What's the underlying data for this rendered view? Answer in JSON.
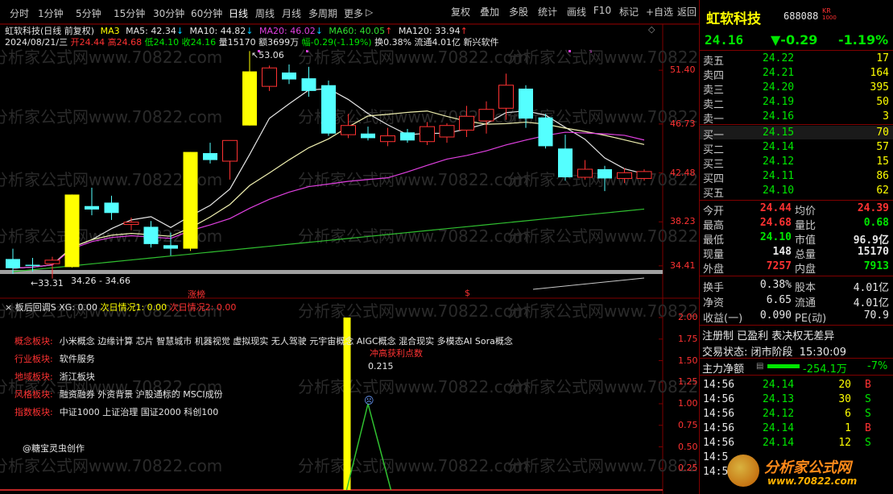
{
  "toolbar": {
    "periods": [
      "分时",
      "1分钟",
      "5分钟",
      "15分钟",
      "30分钟",
      "60分钟",
      "日线",
      "周线",
      "月线",
      "多周期",
      "更多"
    ],
    "active_period": "日线",
    "more_arrow": "▷",
    "buttons": [
      "复权",
      "叠加",
      "多股",
      "统计",
      "画线",
      "F10",
      "标记",
      "+自选",
      "返回"
    ]
  },
  "chart": {
    "stock_label": "虹软科技(日线 前复权)",
    "ma3": "MA3",
    "ma5": "MA5: 42.34",
    "ma5_arrow": "↓",
    "ma10": "MA10: 44.82",
    "ma10_arrow": "↓",
    "ma20": "MA20: 46.02",
    "ma20_arrow": "↓",
    "ma60": "MA60: 40.05",
    "ma60_arrow": "↑",
    "ma120": "MA120: 33.94",
    "ma120_arrow": "↑",
    "date": "2024/08/21/三",
    "open": "开24.44",
    "high": "高24.68",
    "low": "低24.10",
    "close": "收24.16",
    "volume": "量15170",
    "amount": "额3699万",
    "change": "幅-0.29(-1.19%)",
    "turnover": "换0.38%",
    "float": "流通4.01亿",
    "sector": "新兴软件",
    "y_ticks": [
      "51.40",
      "46.73",
      "42.48",
      "38.23",
      "34.41"
    ],
    "y_values": [
      51.4,
      46.73,
      42.48,
      38.23,
      34.41
    ],
    "high_mark": "53.06",
    "low_mark": "33.31",
    "range_text": "34.26 - 34.66",
    "tag_zt": "涨榜",
    "tag_s": "$",
    "candles": [
      {
        "o": 35.0,
        "h": 35.9,
        "l": 33.7,
        "c": 34.2
      },
      {
        "o": 34.5,
        "h": 35.1,
        "l": 33.9,
        "c": 34.4
      },
      {
        "o": 34.6,
        "h": 35.2,
        "l": 33.31,
        "c": 34.9
      },
      {
        "o": 34.3,
        "h": 40.6,
        "l": 34.26,
        "c": 40.6
      },
      {
        "o": 39.6,
        "h": 41.2,
        "l": 38.8,
        "c": 39.3
      },
      {
        "o": 39.9,
        "h": 40.5,
        "l": 38.4,
        "c": 39.0
      },
      {
        "o": 38.0,
        "h": 38.6,
        "l": 37.5,
        "c": 38.2
      },
      {
        "o": 37.8,
        "h": 38.3,
        "l": 36.0,
        "c": 36.3
      },
      {
        "o": 36.2,
        "h": 37.3,
        "l": 35.3,
        "c": 35.9
      },
      {
        "o": 35.9,
        "h": 44.3,
        "l": 35.7,
        "c": 44.3
      },
      {
        "o": 44.2,
        "h": 45.1,
        "l": 43.3,
        "c": 43.6
      },
      {
        "o": 43.5,
        "h": 45.3,
        "l": 41.9,
        "c": 45.3
      },
      {
        "o": 46.6,
        "h": 53.06,
        "l": 46.6,
        "c": 51.3
      },
      {
        "o": 50.0,
        "h": 51.8,
        "l": 49.6,
        "c": 51.6
      },
      {
        "o": 51.2,
        "h": 51.9,
        "l": 50.2,
        "c": 50.6
      },
      {
        "o": 50.7,
        "h": 51.7,
        "l": 49.1,
        "c": 49.6
      },
      {
        "o": 50.1,
        "h": 50.5,
        "l": 45.7,
        "c": 45.9
      },
      {
        "o": 45.8,
        "h": 47.6,
        "l": 45.5,
        "c": 46.6
      },
      {
        "o": 45.9,
        "h": 46.5,
        "l": 45.3,
        "c": 45.5
      },
      {
        "o": 45.2,
        "h": 46.4,
        "l": 44.8,
        "c": 45.7
      },
      {
        "o": 46.0,
        "h": 46.3,
        "l": 45.1,
        "c": 45.3
      },
      {
        "o": 45.2,
        "h": 46.9,
        "l": 44.9,
        "c": 46.5
      },
      {
        "o": 45.6,
        "h": 46.8,
        "l": 45.1,
        "c": 46.6
      },
      {
        "o": 46.2,
        "h": 48.3,
        "l": 45.6,
        "c": 47.4
      },
      {
        "o": 47.0,
        "h": 48.7,
        "l": 45.9,
        "c": 48.0
      },
      {
        "o": 48.1,
        "h": 51.1,
        "l": 47.1,
        "c": 50.1
      },
      {
        "o": 49.8,
        "h": 50.1,
        "l": 46.4,
        "c": 47.2
      },
      {
        "o": 47.3,
        "h": 47.6,
        "l": 44.6,
        "c": 44.8
      },
      {
        "o": 44.6,
        "h": 45.8,
        "l": 41.8,
        "c": 42.1
      },
      {
        "o": 42.1,
        "h": 43.6,
        "l": 41.9,
        "c": 42.8
      },
      {
        "o": 42.8,
        "h": 43.1,
        "l": 40.9,
        "c": 42.0
      },
      {
        "o": 42.0,
        "h": 42.9,
        "l": 41.6,
        "c": 42.5
      },
      {
        "o": 42.0,
        "h": 42.8,
        "l": 41.8,
        "c": 42.6
      }
    ]
  },
  "indicator": {
    "title": "板后回调S",
    "xg": "XG: 0.00",
    "cond1": "次日情况1: 0.00",
    "cond2": "次日情况2: 0.00",
    "y_ticks": [
      "2.00",
      "1.75",
      "1.50",
      "1.25",
      "1.00",
      "0.75",
      "0.50",
      "0.25"
    ],
    "y_values": [
      2.0,
      1.75,
      1.5,
      1.25,
      1.0,
      0.75,
      0.5,
      0.25
    ],
    "annotation": "冲高获利点数",
    "annotation_value": "0.215",
    "tags": [
      {
        "label": "概念板块:",
        "value": "小米概念 边缘计算 芯片 智慧城市 机器视觉 虚拟现实 无人驾驶 元宇宙概念 AIGC概念 混合现实 多模态AI Sora概念"
      },
      {
        "label": "行业板块:",
        "value": "软件服务"
      },
      {
        "label": "地域板块:",
        "value": "浙江板块"
      },
      {
        "label": "风格板块:",
        "value": "融资融券 外资背景 沪股通标的 MSCI成份"
      },
      {
        "label": "指数板块:",
        "value": "中证1000 上证治理 国证2000 科创100"
      }
    ],
    "credit": "@糖宝灵虫创作"
  },
  "watermark": "分析家公式网www.70822.com",
  "quote": {
    "name": "虹软科技",
    "code": "688088",
    "badge_top": "KR",
    "badge_bottom": "1000",
    "price": "24.16",
    "change": "▼-0.29",
    "change_pct": "-1.19%",
    "asks": [
      {
        "label": "卖五",
        "price": "24.22",
        "vol": "17"
      },
      {
        "label": "卖四",
        "price": "24.21",
        "vol": "164"
      },
      {
        "label": "卖三",
        "price": "24.20",
        "vol": "395"
      },
      {
        "label": "卖二",
        "price": "24.19",
        "vol": "50"
      },
      {
        "label": "卖一",
        "price": "24.16",
        "vol": "3"
      }
    ],
    "bids": [
      {
        "label": "买一",
        "price": "24.15",
        "vol": "70"
      },
      {
        "label": "买二",
        "price": "24.14",
        "vol": "57"
      },
      {
        "label": "买三",
        "price": "24.12",
        "vol": "15"
      },
      {
        "label": "买四",
        "price": "24.11",
        "vol": "86"
      },
      {
        "label": "买五",
        "price": "24.10",
        "vol": "62"
      }
    ],
    "stats": [
      {
        "l1": "今开",
        "v1": "24.44",
        "l2": "均价",
        "v2": "24.39"
      },
      {
        "l1": "最高",
        "v1": "24.68",
        "l2": "量比",
        "v2": "0.68"
      },
      {
        "l1": "最低",
        "v1": "24.10",
        "l2": "市值",
        "v2": "96.9亿"
      },
      {
        "l1": "现量",
        "v1": "148",
        "l2": "总量",
        "v2": "15170"
      },
      {
        "l1": "外盘",
        "v1": "7257",
        "l2": "内盘",
        "v2": "7913"
      }
    ],
    "stats2": [
      {
        "l1": "换手",
        "v1": "0.38%",
        "l2": "股本",
        "v2": "4.01亿"
      },
      {
        "l1": "净资",
        "v1": "6.65",
        "l2": "流通",
        "v2": "4.01亿"
      },
      {
        "l1": "收益(一)",
        "v1": "0.090",
        "l2": "PE(动)",
        "v2": "70.9"
      }
    ],
    "reg_line": "注册制 已盈利 表决权无差异",
    "status_label": "交易状态:",
    "status_value": "闭市阶段",
    "status_time": "15:30:09",
    "main_flow_label": "主力净额",
    "main_flow_value": "-254.1万",
    "main_flow_pct": "-7%",
    "main_flow_level": 0.25,
    "ticks": [
      {
        "time": "14:56",
        "price": "24.14",
        "vol": "20",
        "side": "B"
      },
      {
        "time": "14:56",
        "price": "24.13",
        "vol": "30",
        "side": "S"
      },
      {
        "time": "14:56",
        "price": "24.12",
        "vol": "6",
        "side": "S"
      },
      {
        "time": "14:56",
        "price": "24.14",
        "vol": "1",
        "side": "B"
      },
      {
        "time": "14:56",
        "price": "24.14",
        "vol": "12",
        "side": "S"
      },
      {
        "time": "14:5",
        "price": "",
        "vol": "",
        "side": ""
      },
      {
        "time": "14:5",
        "price": "",
        "vol": "",
        "side": ""
      }
    ],
    "logo_text": "分析家公式网",
    "logo_url": "www.70822.com"
  },
  "colors": {
    "up": "#ff3232",
    "down": "#00e600",
    "bull_candle": "#ff3232",
    "bear_candle": "#54ffff",
    "limit_up": "#ffff00",
    "ma_white": "#e6e6e6",
    "ma_magenta": "#e040e0",
    "ma_green": "#30c030",
    "grid": "#800000"
  }
}
